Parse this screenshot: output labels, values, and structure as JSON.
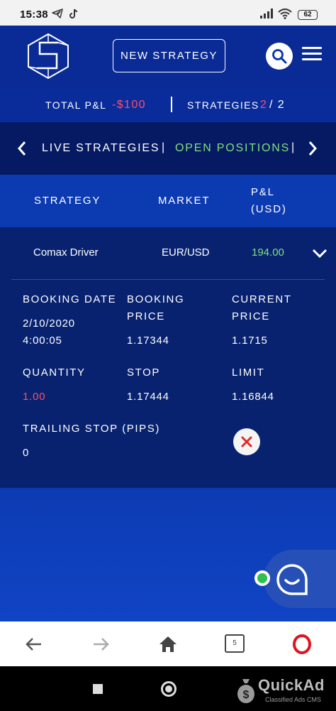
{
  "status_bar": {
    "time": "15:38",
    "battery": "62",
    "icons": [
      "telegram-icon",
      "tiktok-icon",
      "signal-icon",
      "wifi-icon",
      "battery-icon"
    ]
  },
  "header": {
    "new_strategy_label": "NEW STRATEGY",
    "icons": [
      "logo-icon",
      "search-icon",
      "menu-icon"
    ]
  },
  "summary": {
    "total_pl_label": "TOTAL P&L",
    "total_pl_value": "-$100",
    "strategies_label": "STRATEGIES",
    "strategies_active": "2",
    "strategies_total": "/ 2"
  },
  "tabs": {
    "live": "LIVE STRATEGIES",
    "separator": "|",
    "open": "OPEN POSITIONS",
    "active_tab": "open"
  },
  "table": {
    "headers": {
      "strategy": "STRATEGY",
      "market": "MARKET",
      "pnl_line1": "P&L",
      "pnl_line2": "(USD)"
    },
    "row": {
      "strategy": "Comax Driver",
      "market": "EUR/USD",
      "pnl": "194.00"
    }
  },
  "details": {
    "booking_date_label": "BOOKING DATE",
    "booking_date_value_1": "2/10/2020",
    "booking_date_value_2": "4:00:05",
    "booking_price_label_1": "BOOKING",
    "booking_price_label_2": "PRICE",
    "booking_price_value": "1.17344",
    "current_price_label_1": "CURRENT",
    "current_price_label_2": "PRICE",
    "current_price_value": "1.1715",
    "quantity_label": "QUANTITY",
    "quantity_value": "1.00",
    "stop_label": "STOP",
    "stop_value": "1.17444",
    "limit_label": "LIMIT",
    "limit_value": "1.16844",
    "trailing_stop_label": "TRAILING STOP (PIPS)",
    "trailing_stop_value": "0"
  },
  "browser_bar": {
    "tab_count": "5",
    "icons": [
      "back-icon",
      "forward-icon",
      "home-icon",
      "tabs-icon",
      "opera-icon"
    ]
  },
  "watermark": {
    "title": "QuickAd",
    "subtitle": "Classified Ads CMS"
  },
  "colors": {
    "accent_red": "#ff4d6a",
    "accent_green": "#7ee07e",
    "header_blue": "#0a2b95",
    "panel_navy": "#08226f"
  }
}
